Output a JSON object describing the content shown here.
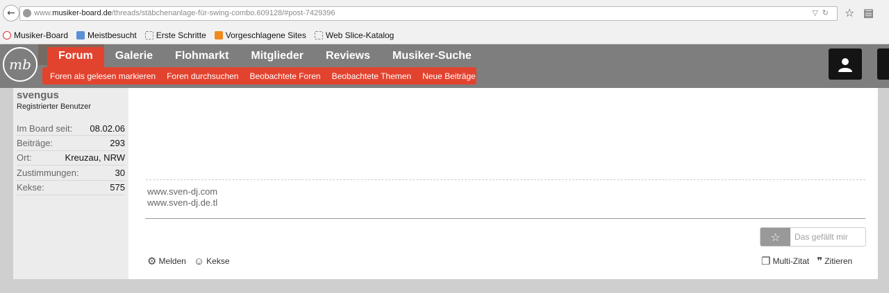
{
  "browser": {
    "url_prefix": "www.",
    "url_domain": "musiker-board.de",
    "url_path": "/threads/stäbchenanlage-für-swing-combo.609128/#post-7429396",
    "bookmarks": [
      "Musiker-Board",
      "Meistbesucht",
      "Erste Schritte",
      "Vorgeschlagene Sites",
      "Web Slice-Katalog"
    ]
  },
  "header": {
    "logo_text": "mb",
    "nav": [
      "Forum",
      "Galerie",
      "Flohmarkt",
      "Mitglieder",
      "Reviews",
      "Musiker-Suche"
    ],
    "active_nav": "Forum",
    "subnav": [
      "Foren als gelesen markieren",
      "Foren durchsuchen",
      "Beobachtete Foren",
      "Beobachtete Themen",
      "Neue Beiträge"
    ],
    "accent_color": "#e2432f"
  },
  "user": {
    "name": "svengus",
    "title": "Registrierter Benutzer",
    "stats": [
      {
        "label": "Im Board seit:",
        "value": "08.02.06"
      },
      {
        "label": "Beiträge:",
        "value": "293"
      },
      {
        "label": "Ort:",
        "value": "Kreuzau, NRW"
      },
      {
        "label": "Zustimmungen:",
        "value": "30"
      },
      {
        "label": "Kekse:",
        "value": "575"
      }
    ]
  },
  "post": {
    "signature": [
      "www.sven-dj.com",
      "www.sven-dj.de.tl"
    ],
    "like_label": "Das gefällt mir",
    "actions_left": [
      "Melden",
      "Kekse"
    ],
    "actions_right": [
      "Multi-Zitat",
      "Zitieren"
    ]
  }
}
